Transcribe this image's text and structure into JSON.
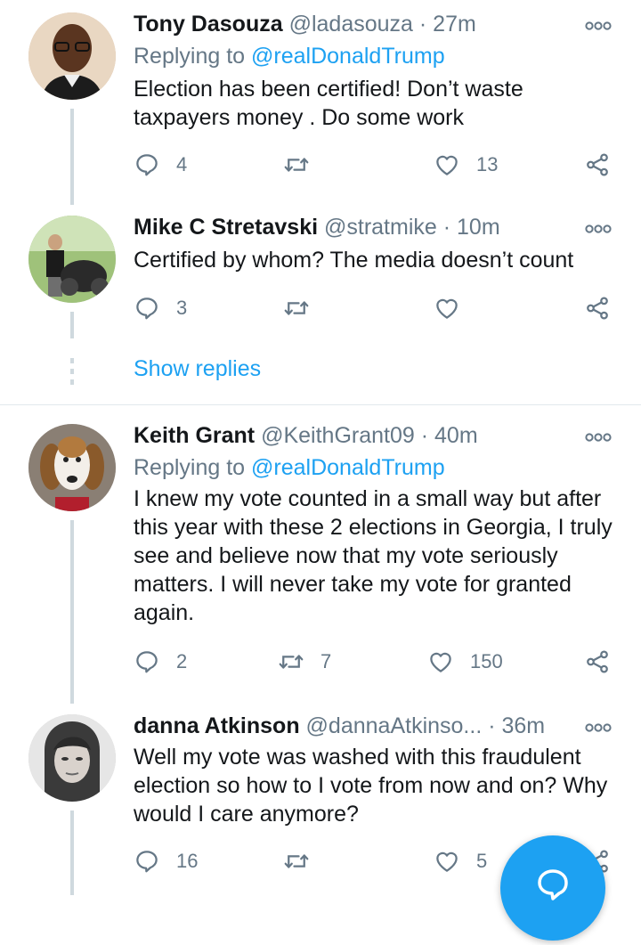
{
  "tweets": [
    {
      "name": "Tony Dasouza",
      "handle": "@ladasouza",
      "sep": "·",
      "time": "27m",
      "replying_prefix": "Replying to ",
      "replying_handle": "@realDonaldTrump",
      "text": "Election has been certified! Don’t waste taxpayers money . Do some work",
      "replies": "4",
      "retweets": "",
      "likes": "13"
    },
    {
      "name": "Mike C Stretavski",
      "handle": "@stratmike",
      "sep": "·",
      "time": "10m",
      "text": "Certified by whom? The media doesn’t count",
      "replies": "3",
      "retweets": "",
      "likes": ""
    },
    {
      "name": "Keith Grant",
      "handle": "@KeithGrant09",
      "sep": "·",
      "time": "40m",
      "replying_prefix": "Replying to ",
      "replying_handle": "@realDonaldTrump",
      "text": "I knew my vote counted in a small way but after this year with these 2 elections in Georgia, I truly see and believe now that my vote seriously matters. I will never take my vote for granted again.",
      "replies": "2",
      "retweets": "7",
      "likes": "150"
    },
    {
      "name": "danna Atkinson",
      "handle": "@dannaAtkinso...",
      "sep": "·",
      "time": "36m",
      "text": "Well my vote was washed with this fraudulent election so how to I vote from now and on? Why would I care anymore?",
      "replies": "16",
      "retweets": "",
      "likes": "5"
    }
  ],
  "show_replies": "Show replies",
  "colors": {
    "accent": "#1da1f2",
    "muted": "#657786",
    "text": "#14171a",
    "line": "#cfd9de"
  },
  "icons": [
    "reply-icon",
    "retweet-icon",
    "like-icon",
    "share-icon",
    "more-icon",
    "compose-icon"
  ]
}
